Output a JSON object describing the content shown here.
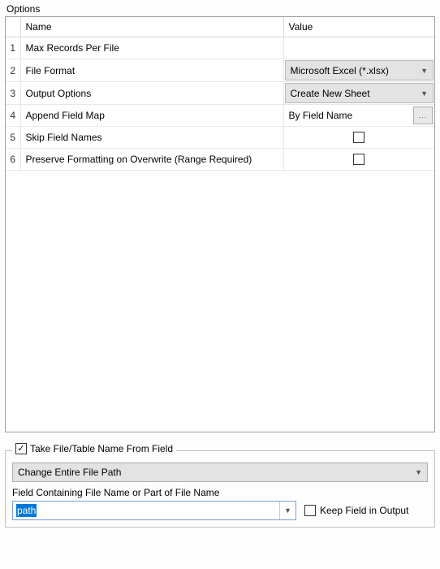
{
  "title": "Options",
  "headers": {
    "name": "Name",
    "value": "Value"
  },
  "rows": [
    {
      "num": "1",
      "name": "Max Records Per File",
      "type": "text",
      "value": ""
    },
    {
      "num": "2",
      "name": "File Format",
      "type": "dropdown",
      "value": "Microsoft Excel (*.xlsx)"
    },
    {
      "num": "3",
      "name": "Output Options",
      "type": "dropdown",
      "value": "Create New Sheet"
    },
    {
      "num": "4",
      "name": "Append Field Map",
      "type": "browse",
      "value": "By Field Name"
    },
    {
      "num": "5",
      "name": "Skip Field Names",
      "type": "checkbox",
      "checked": false
    },
    {
      "num": "6",
      "name": "Preserve Formatting on Overwrite (Range Required)",
      "type": "checkbox",
      "checked": false
    }
  ],
  "takeFileName": {
    "label": "Take File/Table Name From Field",
    "checked": true,
    "pathOption": "Change Entire File Path",
    "fieldLabel": "Field Containing File Name or Part of File Name",
    "fieldValue": "path",
    "keepFieldLabel": "Keep Field in Output",
    "keepFieldChecked": false
  }
}
